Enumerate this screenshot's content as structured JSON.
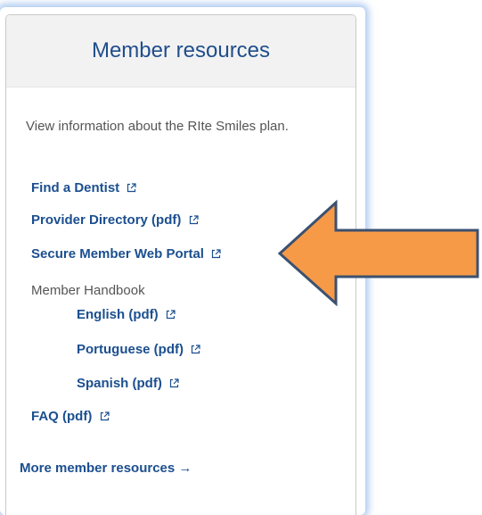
{
  "panel": {
    "title": "Member resources",
    "intro": "View information about the RIte Smiles plan."
  },
  "links": {
    "find_dentist": "Find a Dentist",
    "provider_directory": "Provider Directory (pdf)",
    "secure_portal": "Secure Member Web Portal",
    "handbook_label": "Member Handbook",
    "english": "English (pdf)",
    "portuguese": "Portuguese (pdf)",
    "spanish": "Spanish (pdf)",
    "faq": "FAQ (pdf)",
    "more": "More member resources →"
  },
  "colors": {
    "link": "#1b4f8f",
    "title": "#1f4e8c",
    "arrow_fill": "#f79a48",
    "arrow_stroke": "#3b5170"
  },
  "icons": {
    "external": "external-link-icon",
    "arrow": "orange-left-arrow"
  }
}
